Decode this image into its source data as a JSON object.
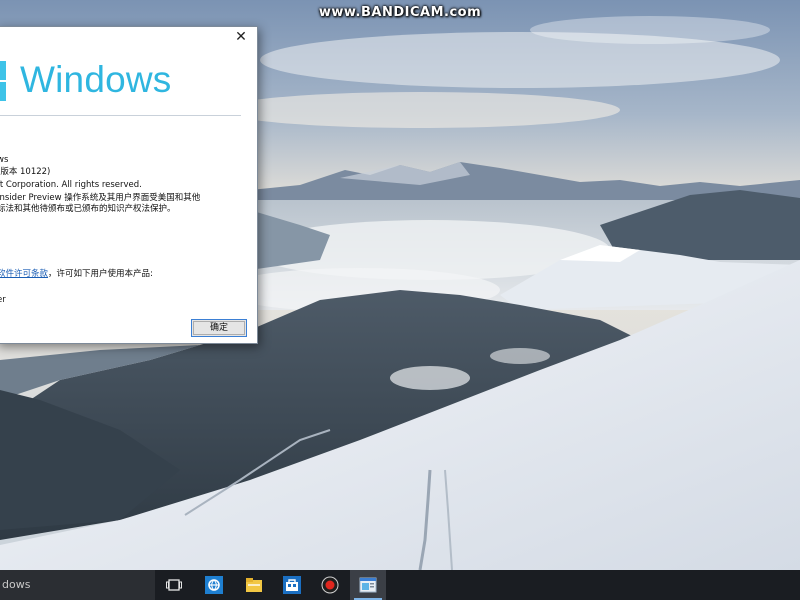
{
  "watermark": "www.BANDICAM.com",
  "dialog": {
    "close_glyph": "✕",
    "brand": "Windows",
    "lines": [
      "ws",
      "(版本 10122)",
      "ft Corporation. All rights reserved.",
      "Insider Preview 操作系统及其用户界面受美国和其他",
      "标法和其他待颁布或已颁布的知识产权法保护。"
    ],
    "license_link": "软件许可条款",
    "license_rest": "，许可如下用户使用本产品:",
    "licensee": "er",
    "ok_label": "确定"
  },
  "taskbar": {
    "search_placeholder": "dows",
    "icons": [
      "task-view-icon",
      "ie-browser-icon",
      "file-explorer-icon",
      "store-icon",
      "record-icon",
      "about-window-icon"
    ]
  },
  "colors": {
    "brand_blue": "#2fb6e0",
    "link_blue": "#1a5db4",
    "taskbar": "#1a1d22"
  }
}
